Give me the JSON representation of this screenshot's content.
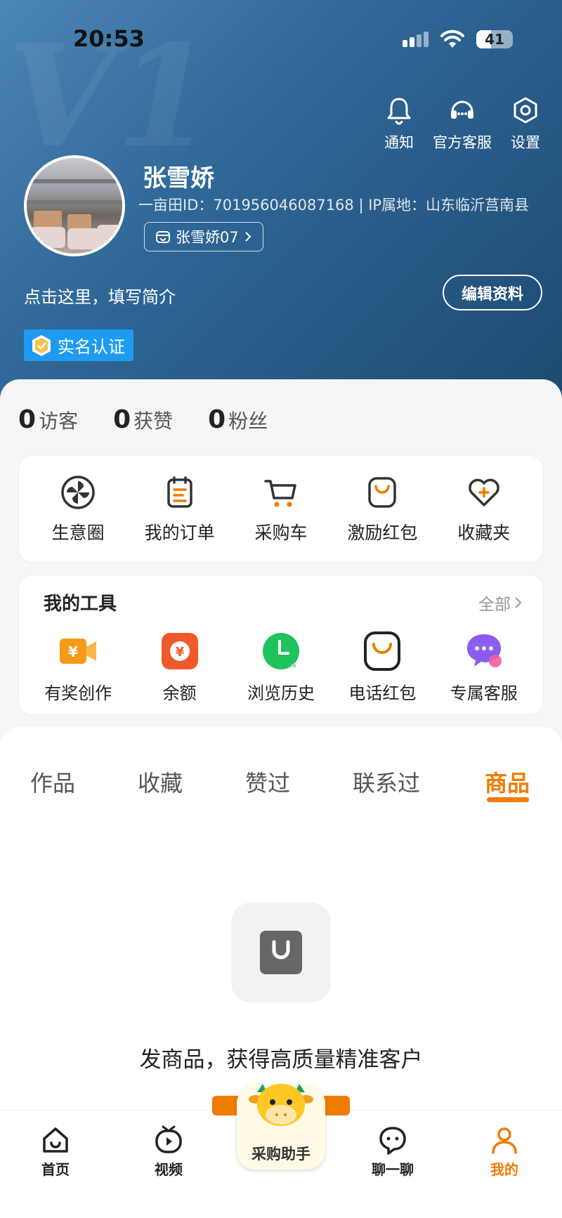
{
  "status_bar": {
    "time": "20:53",
    "battery": "41"
  },
  "header": {
    "watermark": "V1",
    "actions": [
      {
        "label": "通知",
        "icon": "bell-icon"
      },
      {
        "label": "官方客服",
        "icon": "headset-icon"
      },
      {
        "label": "设置",
        "icon": "settings-icon"
      }
    ],
    "username": "张雪娇",
    "user_id_line": "一亩田ID：701956046087168 | IP属地：山东临沂莒南县",
    "shop_name": "张雪娇07",
    "intro_placeholder": "点击这里，填写简介",
    "edit_button": "编辑资料",
    "verify_badge": "实名认证"
  },
  "stats": [
    {
      "count": "0",
      "label": "访客"
    },
    {
      "count": "0",
      "label": "获赞"
    },
    {
      "count": "0",
      "label": "粉丝"
    }
  ],
  "quick_links": [
    {
      "label": "生意圈",
      "icon": "pinwheel-icon"
    },
    {
      "label": "我的订单",
      "icon": "order-clipboard-icon"
    },
    {
      "label": "采购车",
      "icon": "cart-icon"
    },
    {
      "label": "激励红包",
      "icon": "red-packet-icon"
    },
    {
      "label": "收藏夹",
      "icon": "heart-plus-icon"
    }
  ],
  "tools": {
    "title": "我的工具",
    "all_label": "全部",
    "items": [
      {
        "label": "有奖创作",
        "icon": "video-camera-yuan-icon"
      },
      {
        "label": "余额",
        "icon": "wallet-yuan-icon"
      },
      {
        "label": "浏览历史",
        "icon": "clock-icon"
      },
      {
        "label": "电话红包",
        "icon": "phone-packet-icon"
      },
      {
        "label": "专属客服",
        "icon": "chat-bubble-icon"
      }
    ]
  },
  "tabs": [
    "作品",
    "收藏",
    "赞过",
    "联系过",
    "商品"
  ],
  "active_tab": "商品",
  "empty_state": {
    "message": "发商品，获得高质量精准客户",
    "icon": "shopping-bag-icon"
  },
  "bottom_nav": {
    "items": [
      {
        "label": "首页",
        "icon": "home-icon"
      },
      {
        "label": "视频",
        "icon": "video-play-icon"
      },
      {
        "label": "采购助手",
        "icon": "cow-mascot-icon"
      },
      {
        "label": "聊一聊",
        "icon": "chat-icon"
      },
      {
        "label": "我的",
        "icon": "profile-icon"
      }
    ],
    "active": "我的"
  },
  "colors": {
    "accent": "#f07c00",
    "header_dark": "#1d4a72",
    "verify_blue": "#1e9bf0"
  }
}
